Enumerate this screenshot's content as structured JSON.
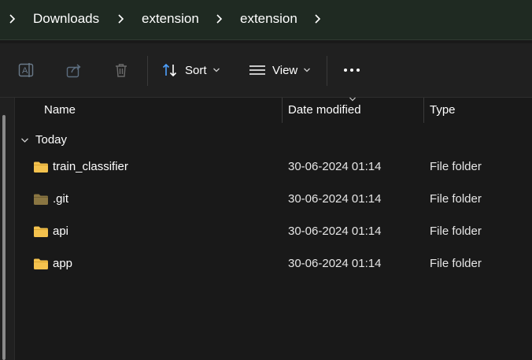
{
  "breadcrumb": {
    "items": [
      "Downloads",
      "extension",
      "extension"
    ]
  },
  "toolbar": {
    "sort_label": "Sort",
    "view_label": "View"
  },
  "columns": {
    "name": "Name",
    "date_modified": "Date modified",
    "type": "Type"
  },
  "group": {
    "label": "Today"
  },
  "rows": [
    {
      "name": "train_classifier",
      "date": "30-06-2024 01:14",
      "type": "File folder",
      "icon": "folder-icon"
    },
    {
      "name": ".git",
      "date": "30-06-2024 01:14",
      "type": "File folder",
      "icon": "folder-hidden-icon"
    },
    {
      "name": "api",
      "date": "30-06-2024 01:14",
      "type": "File folder",
      "icon": "folder-icon"
    },
    {
      "name": "app",
      "date": "30-06-2024 01:14",
      "type": "File folder",
      "icon": "folder-icon"
    }
  ],
  "colors": {
    "folder": "#f4c24e",
    "folder_hidden": "#8a7642",
    "accent_sort": "#4ea1ff"
  }
}
